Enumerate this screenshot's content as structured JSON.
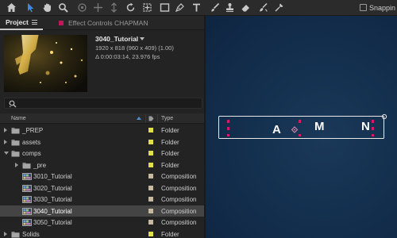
{
  "toolbar": {
    "tools": [
      "home-icon",
      "selection-arrow-icon",
      "hand-icon",
      "zoom-icon",
      "orbit-camera-icon",
      "pan-camera-icon",
      "dolly-camera-icon",
      "rotation-icon",
      "pan-behind-icon",
      "rectangle-icon",
      "pen-icon",
      "text-icon",
      "brush-icon",
      "clone-stamp-icon",
      "eraser-icon",
      "roto-brush-icon",
      "puppet-pin-icon"
    ],
    "active_tool": "selection-arrow-icon",
    "snapping_label": "Snappin"
  },
  "panel": {
    "project_tab": "Project",
    "effect_controls_tab": "Effect Controls CHAPMAN",
    "effect_swatch_color": "#c2185b"
  },
  "composition": {
    "name": "3040_Tutorial",
    "resolution": "1920 x 818  (960 x 409) (1.00)",
    "duration": "Δ 0:00:03:14, 23.976 fps"
  },
  "columns": {
    "name": "Name",
    "type": "Type"
  },
  "items": [
    {
      "name": "_PREP",
      "type": "Folder",
      "kind": "folder",
      "expanded": false,
      "indent": 0
    },
    {
      "name": "assets",
      "type": "Folder",
      "kind": "folder",
      "expanded": false,
      "indent": 0
    },
    {
      "name": "comps",
      "type": "Folder",
      "kind": "folder",
      "expanded": true,
      "indent": 0
    },
    {
      "name": "_pre",
      "type": "Folder",
      "kind": "folder",
      "expanded": false,
      "indent": 1
    },
    {
      "name": "3010_Tutorial",
      "type": "Composition",
      "kind": "comp",
      "indent": 1
    },
    {
      "name": "3020_Tutorial",
      "type": "Composition",
      "kind": "comp",
      "indent": 1
    },
    {
      "name": "3030_Tutorial",
      "type": "Composition",
      "kind": "comp",
      "indent": 1
    },
    {
      "name": "3040_Tutorial",
      "type": "Composition",
      "kind": "comp",
      "indent": 1,
      "selected": true
    },
    {
      "name": "3050_Tutorial",
      "type": "Composition",
      "kind": "comp",
      "indent": 1
    },
    {
      "name": "Solids",
      "type": "Folder",
      "kind": "folder",
      "expanded": false,
      "indent": 0
    }
  ],
  "viewer": {
    "letters": [
      "A",
      "M",
      "N"
    ],
    "handle_color": "#d81b60"
  }
}
